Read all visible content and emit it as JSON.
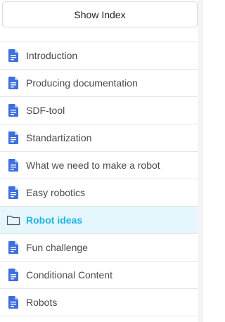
{
  "header": {
    "show_index_label": "Show Index"
  },
  "colors": {
    "active_text": "#1bb4e1",
    "active_bg": "#e5f7fd",
    "doc_icon": "#3d6fe0"
  },
  "nav": {
    "items": [
      {
        "label": "Introduction",
        "icon": "document-icon",
        "active": false
      },
      {
        "label": "Producing documentation",
        "icon": "document-icon",
        "active": false
      },
      {
        "label": "SDF-tool",
        "icon": "document-icon",
        "active": false
      },
      {
        "label": "Standartization",
        "icon": "document-icon",
        "active": false
      },
      {
        "label": "What we need to make a robot",
        "icon": "document-icon",
        "active": false
      },
      {
        "label": "Easy robotics",
        "icon": "document-icon",
        "active": false
      },
      {
        "label": "Robot ideas",
        "icon": "folder-icon",
        "active": true
      },
      {
        "label": "Fun challenge",
        "icon": "document-icon",
        "active": false
      },
      {
        "label": "Conditional Content",
        "icon": "document-icon",
        "active": false
      },
      {
        "label": "Robots",
        "icon": "document-icon",
        "active": false
      }
    ]
  }
}
